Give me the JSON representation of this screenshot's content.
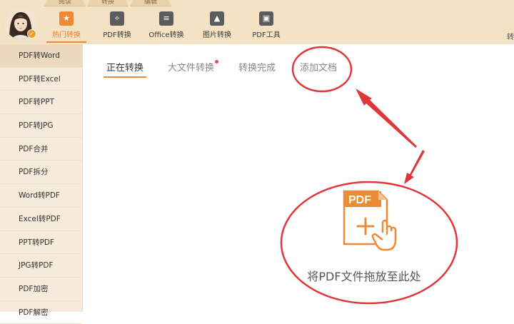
{
  "top_tabs": [
    "阅读",
    "转换",
    "编辑"
  ],
  "toolbar": [
    {
      "label": "热门转换",
      "icon": "star-icon",
      "active": true
    },
    {
      "label": "PDF转换",
      "icon": "pdf-icon",
      "active": false
    },
    {
      "label": "Office转换",
      "icon": "document-icon",
      "active": false
    },
    {
      "label": "图片转换",
      "icon": "image-icon",
      "active": false
    },
    {
      "label": "PDF工具",
      "icon": "toolbox-icon",
      "active": false
    }
  ],
  "topbar_right_text": "转",
  "sidebar": {
    "items": [
      {
        "label": "PDF转Word",
        "active": true
      },
      {
        "label": "PDF转Excel"
      },
      {
        "label": "PDF转PPT"
      },
      {
        "label": "PDF转JPG"
      },
      {
        "label": "PDF合并"
      },
      {
        "label": "PDF拆分"
      },
      {
        "label": "Word转PDF"
      },
      {
        "label": "Excel转PDF"
      },
      {
        "label": "PPT转PDF"
      },
      {
        "label": "JPG转PDF"
      },
      {
        "label": "PDF加密"
      },
      {
        "label": "PDF解密"
      }
    ]
  },
  "main": {
    "tabs": [
      {
        "label": "正在转换",
        "active": true
      },
      {
        "label": "大文件转换",
        "dot": true
      },
      {
        "label": "转换完成"
      },
      {
        "label": "添加文档"
      }
    ],
    "drop_zone": {
      "file_label": "PDF",
      "text": "将PDF文件拖放至此处"
    }
  },
  "colors": {
    "accent": "#ee8a35",
    "toolbar_bg": "#f4e2c5",
    "sidebar_bg": "#f6eadb",
    "annotation_red": "#e0363b",
    "notice_dot": "#f0445a"
  }
}
